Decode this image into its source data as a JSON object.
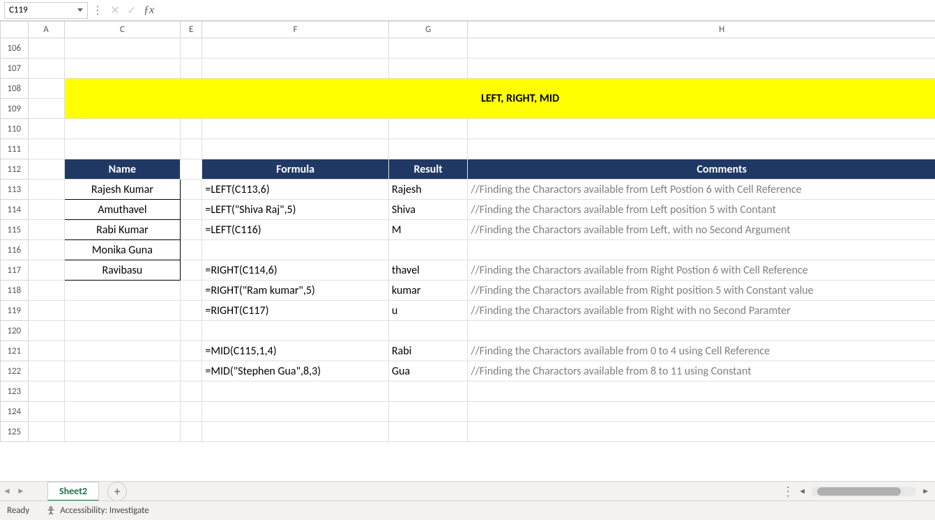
{
  "nameBox": "C119",
  "formulaInput": "",
  "columns": [
    "A",
    "C",
    "E",
    "F",
    "G",
    "H"
  ],
  "rows": [
    "106",
    "107",
    "108",
    "109",
    "110",
    "111",
    "112",
    "113",
    "114",
    "115",
    "116",
    "117",
    "118",
    "119",
    "120",
    "121",
    "122",
    "123",
    "124",
    "125"
  ],
  "banner": "LEFT, RIGHT, MID",
  "headers": {
    "name": "Name",
    "formula": "Formula",
    "result": "Result",
    "comments": "Comments"
  },
  "names": [
    "Rajesh Kumar",
    "Amuthavel",
    "Rabi Kumar",
    "Monika Guna",
    "Ravibasu"
  ],
  "dataRows": [
    {
      "formula": "=LEFT(C113,6)",
      "result": "Rajesh",
      "comment": "//Finding the Charactors available from Left Postion 6 with Cell Reference"
    },
    {
      "formula": "=LEFT(\"Shiva Raj\",5)",
      "result": "Shiva",
      "comment": "//Finding the Charactors available from Left position 5 with Contant"
    },
    {
      "formula": "=LEFT(C116)",
      "result": "M",
      "comment": "//Finding the Charactors available from Left, with no Second Argument"
    },
    {
      "formula": "",
      "result": "",
      "comment": ""
    },
    {
      "formula": "=RIGHT(C114,6)",
      "result": "thavel",
      "comment": "//Finding the Charactors available from Right Postion 6 with Cell Reference"
    },
    {
      "formula": "=RIGHT(\"Ram kumar\",5)",
      "result": "kumar",
      "comment": "//Finding the Charactors available from Right position 5  with Constant value"
    },
    {
      "formula": "=RIGHT(C117)",
      "result": "u",
      "comment": "//Finding the Charactors available from Right with no Second Paramter"
    },
    {
      "formula": "",
      "result": "",
      "comment": ""
    },
    {
      "formula": "=MID(C115,1,4)",
      "result": "Rabi",
      "comment": "//Finding the Charactors available from 0 to 4 using Cell Reference"
    },
    {
      "formula": "=MID(\"Stephen Gua\",8,3)",
      "result": "Gua",
      "comment": "//Finding the Charactors available from 8 to 11 using Constant"
    }
  ],
  "sheetName": "Sheet2",
  "statusReady": "Ready",
  "accessibility": "Accessibility: Investigate"
}
